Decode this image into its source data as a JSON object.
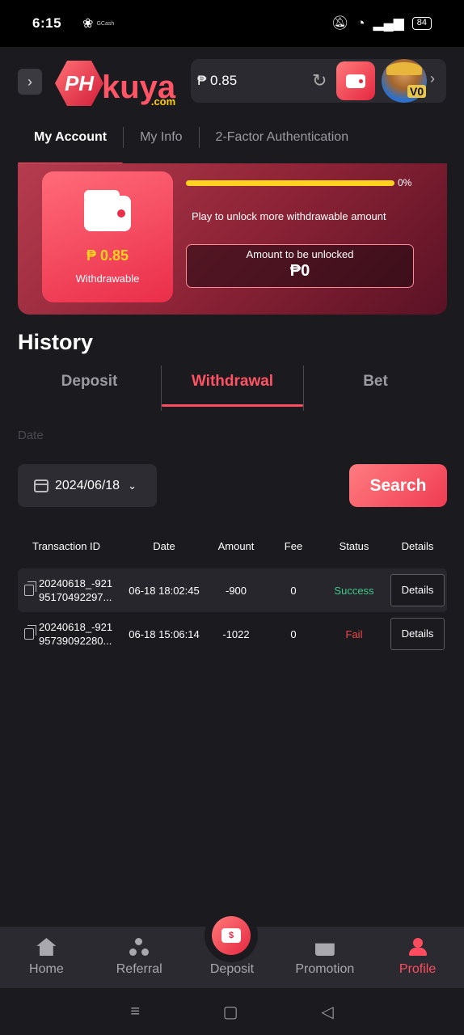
{
  "status_bar": {
    "time": "6:15",
    "app_label": "GCash",
    "battery": "84"
  },
  "header": {
    "logo_main": "PH",
    "logo_text": "kuya",
    "logo_domain": ".com",
    "balance": "₱ 0.85",
    "vip_level": "V0"
  },
  "account_tabs": [
    {
      "label": "My Account",
      "active": true
    },
    {
      "label": "My Info",
      "active": false
    },
    {
      "label": "2-Factor Authentication",
      "active": false
    }
  ],
  "withdraw_card": {
    "amount": "₱ 0.85",
    "label": "Withdrawable",
    "progress_percent": 0,
    "progress_label": "0%",
    "unlock_message": "Play to unlock more withdrawable amount",
    "unlock_box_label": "Amount to be unlocked",
    "unlock_amount": "₱0"
  },
  "history": {
    "title": "History",
    "tabs": [
      {
        "label": "Deposit",
        "active": false
      },
      {
        "label": "Withdrawal",
        "active": true
      },
      {
        "label": "Bet",
        "active": false
      }
    ],
    "date_label": "Date",
    "date_value": "2024/06/18",
    "search_label": "Search"
  },
  "table": {
    "headers": [
      "Transaction ID",
      "Date",
      "Amount",
      "Fee",
      "Status",
      "Details"
    ],
    "rows": [
      {
        "id_line1": "20240618_-921",
        "id_line2": "95170492297...",
        "date": "06-18 18:02:45",
        "amount": "-900",
        "fee": "0",
        "status": "Success",
        "details": "Details"
      },
      {
        "id_line1": "20240618_-921",
        "id_line2": "95739092280...",
        "date": "06-18 15:06:14",
        "amount": "-1022",
        "fee": "0",
        "status": "Fail",
        "details": "Details"
      }
    ]
  },
  "bottom_nav": [
    {
      "label": "Home",
      "icon": "home-icon",
      "active": false
    },
    {
      "label": "Referral",
      "icon": "referral-icon",
      "active": false
    },
    {
      "label": "Deposit",
      "icon": "deposit-wallet-icon",
      "active": false
    },
    {
      "label": "Promotion",
      "icon": "gift-icon",
      "active": false
    },
    {
      "label": "Profile",
      "icon": "profile-icon",
      "active": true
    }
  ],
  "colors": {
    "accent": "#ff4d5f",
    "success": "#3fc889",
    "fail": "#f04747",
    "gold": "#ffd21f"
  }
}
